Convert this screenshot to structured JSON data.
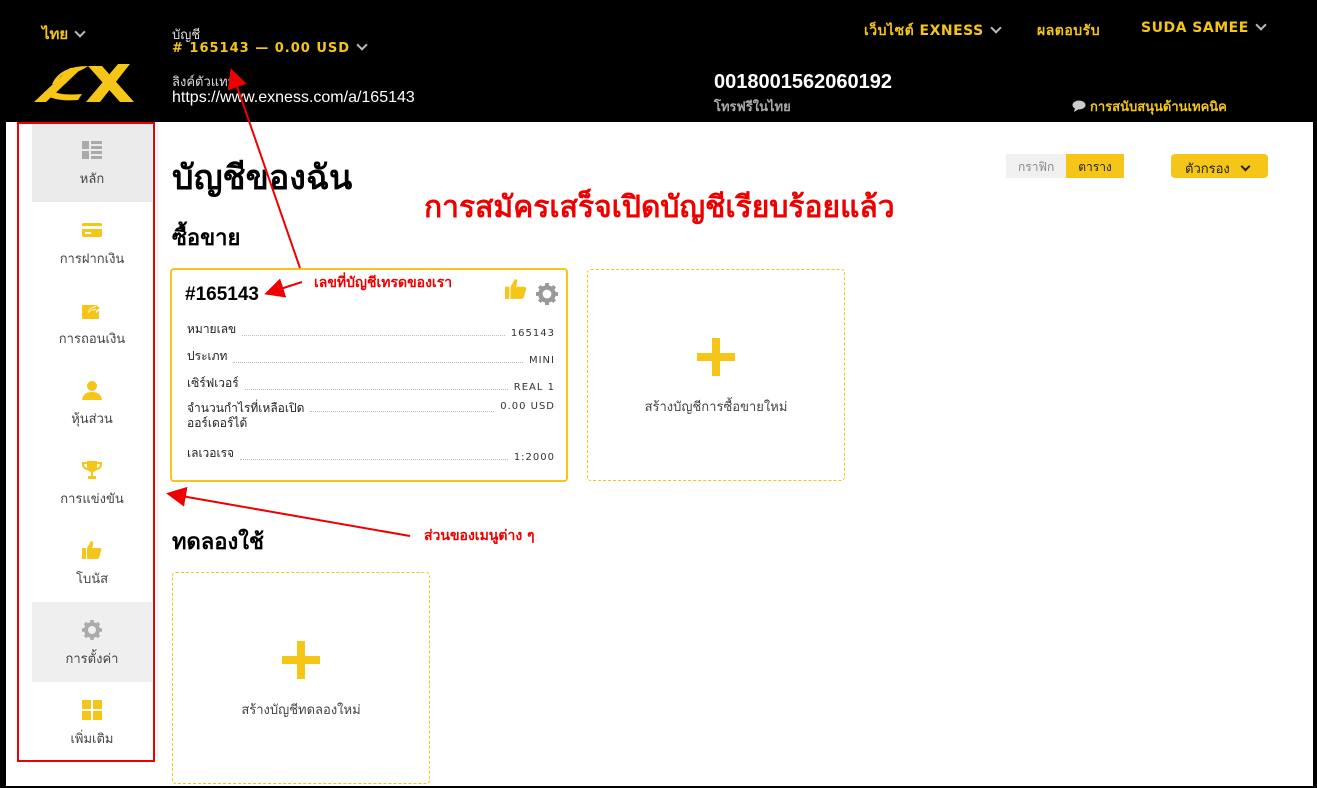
{
  "header": {
    "language": "ไทย",
    "account_label": "บัญชี",
    "account_value": "# 165143 — 0.00 USD",
    "partner_label": "ลิงค์ตัวแทน",
    "partner_url": "https://www.exness.com/a/165143",
    "phone": "0018001562060192",
    "phone_sub": "โทรฟรีในไทย",
    "site_link": "เว็บไซต์ EXNESS",
    "feedback_link": "ผลตอบรับ",
    "user_name": "SUDA SAMEE",
    "support_link": "การสนับสนุนด้านเทคนิค"
  },
  "sidebar": {
    "items": [
      {
        "label": "หลัก"
      },
      {
        "label": "การฝากเงิน"
      },
      {
        "label": "การถอนเงิน"
      },
      {
        "label": "หุ้นส่วน"
      },
      {
        "label": "การแข่งขัน"
      },
      {
        "label": "โบนัส"
      },
      {
        "label": "การตั้งค่า"
      },
      {
        "label": "เพิ่มเติม"
      }
    ]
  },
  "main": {
    "page_title": "บัญชีของฉัน",
    "view_graph": "กราฟิก",
    "view_table": "ตาราง",
    "filter_label": "ตัวกรอง",
    "trading_section": "ซื้อขาย",
    "demo_section": "ทดลองใช้",
    "account_card": {
      "number": "#165143",
      "rows": [
        {
          "key": "หมายเลข",
          "value": "165143"
        },
        {
          "key": "ประเภท",
          "value": "MINI"
        },
        {
          "key": "เซิร์ฟเวอร์",
          "value": "REAL 1"
        },
        {
          "key": "จำนวนกำไรที่เหลือเปิด",
          "key2": "ออร์เดอร์ได้",
          "value": "0.00 USD"
        },
        {
          "key": "เลเวอเรจ",
          "value": "1:2000"
        }
      ]
    },
    "new_trading_account": "สร้างบัญชีการซื้อขายใหม่",
    "new_demo_account": "สร้างบัญชีทดลองใหม่"
  },
  "annotations": {
    "success": "การสมัครเสร็จเปิดบัญชีเรียบร้อยแล้ว",
    "account_number_note": "เลขที่บัญชีเทรดของเรา",
    "menu_note": "ส่วนของเมนูต่าง ๆ"
  },
  "colors": {
    "accent": "#f5c518",
    "annotation": "#e00000",
    "header_bg": "#000000"
  }
}
